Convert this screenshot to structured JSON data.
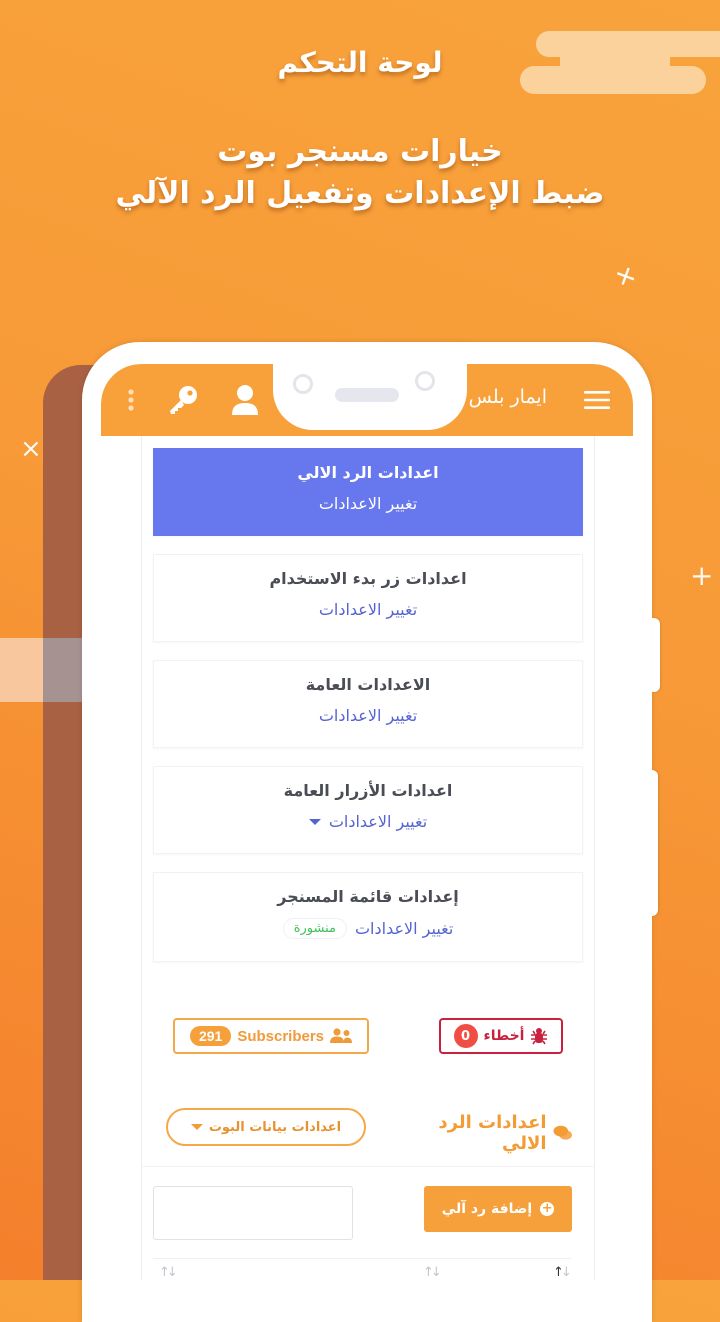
{
  "promo": {
    "headline": "لوحة التحكم",
    "subtitle_line1": "خيارات مسنجر بوت",
    "subtitle_line2": "ضبط الإعدادات وتفعيل الرد الآلي"
  },
  "appbar": {
    "title": "ايمار بلس",
    "icons": [
      "menu-icon",
      "user-icon",
      "key-icon",
      "more-vertical-icon"
    ]
  },
  "settings_cards": [
    {
      "title": "اعدادات الرد الالي",
      "link": "تغيير الاعدادات",
      "active": true
    },
    {
      "title": "اعدادات زر بدء الاستخدام",
      "link": "تغيير الاعدادات",
      "active": false
    },
    {
      "title": "الاعدادات العامة",
      "link": "تغيير الاعدادات",
      "active": false
    },
    {
      "title": "اعدادات الأزرار العامة",
      "link": "تغيير الاعدادات",
      "has_dropdown": true,
      "active": false
    },
    {
      "title": "إعدادات قائمة المسنجر",
      "link": "تغيير الاعدادات",
      "status": "منشورة",
      "active": false
    }
  ],
  "stats": {
    "subscribers_label": "Subscribers",
    "subscribers_count": "291",
    "errors_label": "أخطاء",
    "errors_count": "0"
  },
  "auto_reply": {
    "section_title": "اعدادات الرد الالي",
    "bot_settings_button": "اعدادات بيانات البوت",
    "add_button": "إضافة رد آلي",
    "search_value": "",
    "sort_indicator": "↑↓"
  },
  "colors": {
    "accent_orange": "#f8a13a",
    "active_card_blue": "#6778ee",
    "link_blue": "#5664d2",
    "error_red": "#c8223f",
    "status_green": "#3ec15a"
  }
}
